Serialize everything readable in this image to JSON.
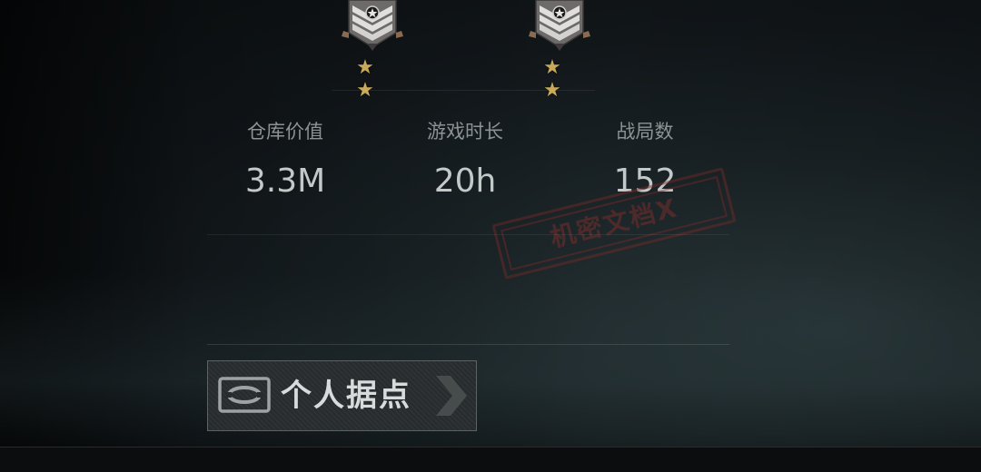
{
  "ranks": [
    {
      "stars": "★ ★"
    },
    {
      "stars": "★ ★"
    }
  ],
  "stats": [
    {
      "label": "仓库价值",
      "value": "3.3M"
    },
    {
      "label": "游戏时长",
      "value": "20h"
    },
    {
      "label": "战局数",
      "value": "152"
    }
  ],
  "stamp": {
    "text": "机密文档X"
  },
  "base_button": {
    "label": "个人据点"
  },
  "colors": {
    "accent_gold": "#c9aa5a",
    "stamp_red": "#8a2f2c",
    "label_gray": "#8d9394",
    "value_gray": "#c3c8c9"
  }
}
